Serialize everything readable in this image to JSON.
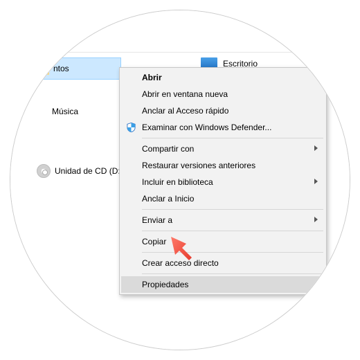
{
  "background": {
    "selected_folder_label": "ntos",
    "desktop_label": "Escritorio",
    "sidebar": {
      "music_label": "Música",
      "cd_label": "Unidad de CD (D:)"
    }
  },
  "context_menu": {
    "open": "Abrir",
    "open_new_window": "Abrir en ventana nueva",
    "pin_quick_access": "Anclar al Acceso rápido",
    "scan_defender": "Examinar con Windows Defender...",
    "share_with": "Compartir con",
    "restore_previous": "Restaurar versiones anteriores",
    "include_library": "Incluir en biblioteca",
    "pin_start": "Anclar a Inicio",
    "send_to": "Enviar a",
    "copy": "Copiar",
    "create_shortcut": "Crear acceso directo",
    "properties": "Propiedades"
  }
}
